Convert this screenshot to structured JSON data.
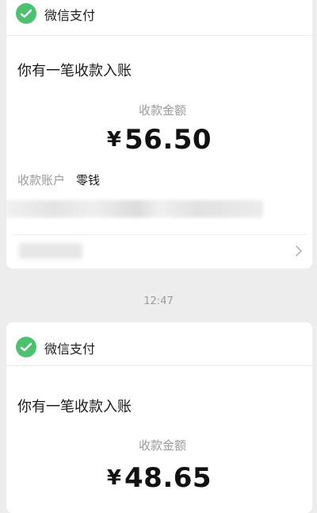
{
  "messages": [
    {
      "brand": "微信支付",
      "title": "你有一笔收款入账",
      "amount_label": "收款金额",
      "currency_symbol": "¥",
      "amount": "56.50",
      "account_label": "收款账户",
      "account_value": "零钱"
    },
    {
      "brand": "微信支付",
      "title": "你有一笔收款入账",
      "amount_label": "收款金额",
      "currency_symbol": "¥",
      "amount": "48.65"
    }
  ],
  "timestamp": "12:47",
  "colors": {
    "brand_green": "#4cc26f",
    "background": "#ededed",
    "card": "#ffffff",
    "muted_text": "#9a9a9a"
  },
  "icons": {
    "brand": "wechat-pay-icon",
    "details": "chevron-right-icon"
  }
}
